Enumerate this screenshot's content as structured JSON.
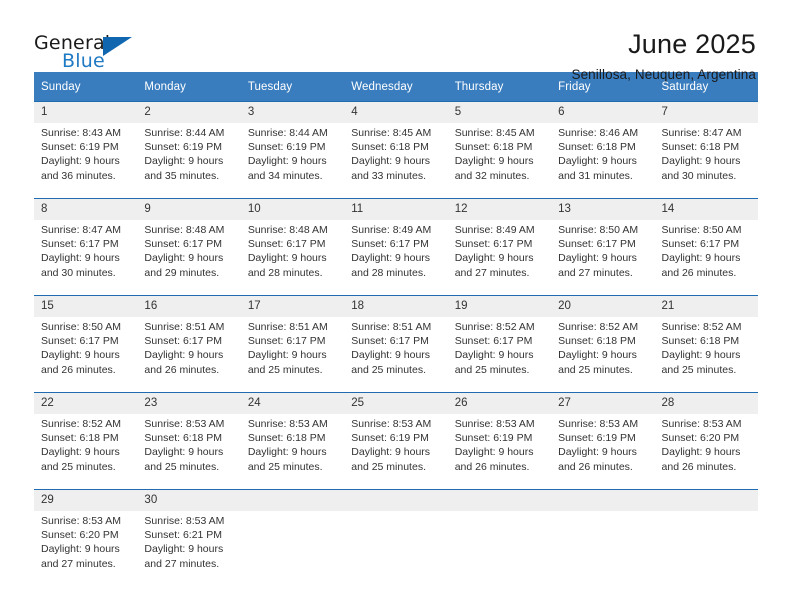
{
  "brand": {
    "name_part1": "General",
    "name_part2": "Blue",
    "triangle_color": "#1166b0",
    "blue_color": "#1f7ac4"
  },
  "header": {
    "title": "June 2025",
    "subtitle": "Senillosa, Neuquen, Argentina"
  },
  "theme": {
    "header_bg": "#3a7dbf",
    "week_divider": "#1f6cb0",
    "daynum_bg": "#efefef"
  },
  "calendar": {
    "weekday_headers": [
      "Sunday",
      "Monday",
      "Tuesday",
      "Wednesday",
      "Thursday",
      "Friday",
      "Saturday"
    ],
    "weeks": [
      [
        {
          "day": "1",
          "info": "Sunrise: 8:43 AM\nSunset: 6:19 PM\nDaylight: 9 hours\nand 36 minutes."
        },
        {
          "day": "2",
          "info": "Sunrise: 8:44 AM\nSunset: 6:19 PM\nDaylight: 9 hours\nand 35 minutes."
        },
        {
          "day": "3",
          "info": "Sunrise: 8:44 AM\nSunset: 6:19 PM\nDaylight: 9 hours\nand 34 minutes."
        },
        {
          "day": "4",
          "info": "Sunrise: 8:45 AM\nSunset: 6:18 PM\nDaylight: 9 hours\nand 33 minutes."
        },
        {
          "day": "5",
          "info": "Sunrise: 8:45 AM\nSunset: 6:18 PM\nDaylight: 9 hours\nand 32 minutes."
        },
        {
          "day": "6",
          "info": "Sunrise: 8:46 AM\nSunset: 6:18 PM\nDaylight: 9 hours\nand 31 minutes."
        },
        {
          "day": "7",
          "info": "Sunrise: 8:47 AM\nSunset: 6:18 PM\nDaylight: 9 hours\nand 30 minutes."
        }
      ],
      [
        {
          "day": "8",
          "info": "Sunrise: 8:47 AM\nSunset: 6:17 PM\nDaylight: 9 hours\nand 30 minutes."
        },
        {
          "day": "9",
          "info": "Sunrise: 8:48 AM\nSunset: 6:17 PM\nDaylight: 9 hours\nand 29 minutes."
        },
        {
          "day": "10",
          "info": "Sunrise: 8:48 AM\nSunset: 6:17 PM\nDaylight: 9 hours\nand 28 minutes."
        },
        {
          "day": "11",
          "info": "Sunrise: 8:49 AM\nSunset: 6:17 PM\nDaylight: 9 hours\nand 28 minutes."
        },
        {
          "day": "12",
          "info": "Sunrise: 8:49 AM\nSunset: 6:17 PM\nDaylight: 9 hours\nand 27 minutes."
        },
        {
          "day": "13",
          "info": "Sunrise: 8:50 AM\nSunset: 6:17 PM\nDaylight: 9 hours\nand 27 minutes."
        },
        {
          "day": "14",
          "info": "Sunrise: 8:50 AM\nSunset: 6:17 PM\nDaylight: 9 hours\nand 26 minutes."
        }
      ],
      [
        {
          "day": "15",
          "info": "Sunrise: 8:50 AM\nSunset: 6:17 PM\nDaylight: 9 hours\nand 26 minutes."
        },
        {
          "day": "16",
          "info": "Sunrise: 8:51 AM\nSunset: 6:17 PM\nDaylight: 9 hours\nand 26 minutes."
        },
        {
          "day": "17",
          "info": "Sunrise: 8:51 AM\nSunset: 6:17 PM\nDaylight: 9 hours\nand 25 minutes."
        },
        {
          "day": "18",
          "info": "Sunrise: 8:51 AM\nSunset: 6:17 PM\nDaylight: 9 hours\nand 25 minutes."
        },
        {
          "day": "19",
          "info": "Sunrise: 8:52 AM\nSunset: 6:17 PM\nDaylight: 9 hours\nand 25 minutes."
        },
        {
          "day": "20",
          "info": "Sunrise: 8:52 AM\nSunset: 6:18 PM\nDaylight: 9 hours\nand 25 minutes."
        },
        {
          "day": "21",
          "info": "Sunrise: 8:52 AM\nSunset: 6:18 PM\nDaylight: 9 hours\nand 25 minutes."
        }
      ],
      [
        {
          "day": "22",
          "info": "Sunrise: 8:52 AM\nSunset: 6:18 PM\nDaylight: 9 hours\nand 25 minutes."
        },
        {
          "day": "23",
          "info": "Sunrise: 8:53 AM\nSunset: 6:18 PM\nDaylight: 9 hours\nand 25 minutes."
        },
        {
          "day": "24",
          "info": "Sunrise: 8:53 AM\nSunset: 6:18 PM\nDaylight: 9 hours\nand 25 minutes."
        },
        {
          "day": "25",
          "info": "Sunrise: 8:53 AM\nSunset: 6:19 PM\nDaylight: 9 hours\nand 25 minutes."
        },
        {
          "day": "26",
          "info": "Sunrise: 8:53 AM\nSunset: 6:19 PM\nDaylight: 9 hours\nand 26 minutes."
        },
        {
          "day": "27",
          "info": "Sunrise: 8:53 AM\nSunset: 6:19 PM\nDaylight: 9 hours\nand 26 minutes."
        },
        {
          "day": "28",
          "info": "Sunrise: 8:53 AM\nSunset: 6:20 PM\nDaylight: 9 hours\nand 26 minutes."
        }
      ],
      [
        {
          "day": "29",
          "info": "Sunrise: 8:53 AM\nSunset: 6:20 PM\nDaylight: 9 hours\nand 27 minutes."
        },
        {
          "day": "30",
          "info": "Sunrise: 8:53 AM\nSunset: 6:21 PM\nDaylight: 9 hours\nand 27 minutes."
        },
        {
          "day": "",
          "info": ""
        },
        {
          "day": "",
          "info": ""
        },
        {
          "day": "",
          "info": ""
        },
        {
          "day": "",
          "info": ""
        },
        {
          "day": "",
          "info": ""
        }
      ]
    ]
  }
}
